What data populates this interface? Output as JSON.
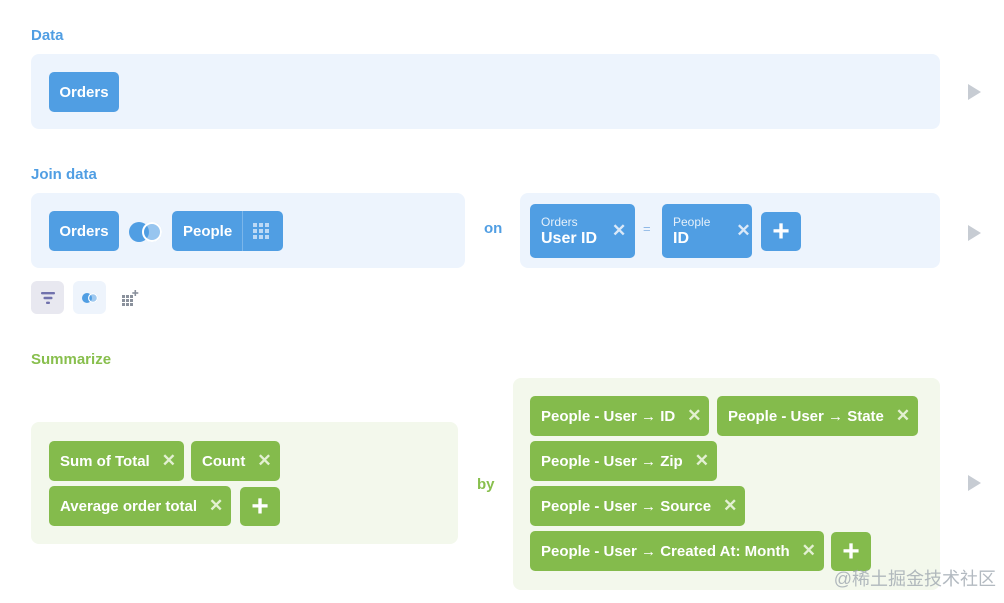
{
  "data_section": {
    "title": "Data",
    "table": "Orders"
  },
  "join_section": {
    "title": "Join data",
    "left_table": "Orders",
    "right_table": "People",
    "on_label": "on",
    "equals": "=",
    "left_key": {
      "table": "Orders",
      "field": "User ID"
    },
    "right_key": {
      "table": "People",
      "field": "ID"
    },
    "icons": {
      "join_type": "venn-icon",
      "grid": "grid-icon"
    }
  },
  "toolbar": {
    "items": [
      "filter-icon",
      "join-icon",
      "custom-column-icon"
    ]
  },
  "summarize_section": {
    "title": "Summarize",
    "by_label": "by",
    "metrics": [
      "Sum of Total",
      "Count",
      "Average order total"
    ],
    "breakouts": [
      "People - User → ID",
      "People - User → State",
      "People - User → Zip",
      "People - User → Source",
      "People - User → Created At: Month"
    ]
  },
  "glyphs": {
    "remove": "✕",
    "add": "+"
  },
  "watermark": "@稀土掘金技术社区",
  "colors": {
    "blue": "#509ee3",
    "green": "#84bb4c",
    "blue_panel": "#edf4fd",
    "green_panel": "#f3f8ec"
  }
}
